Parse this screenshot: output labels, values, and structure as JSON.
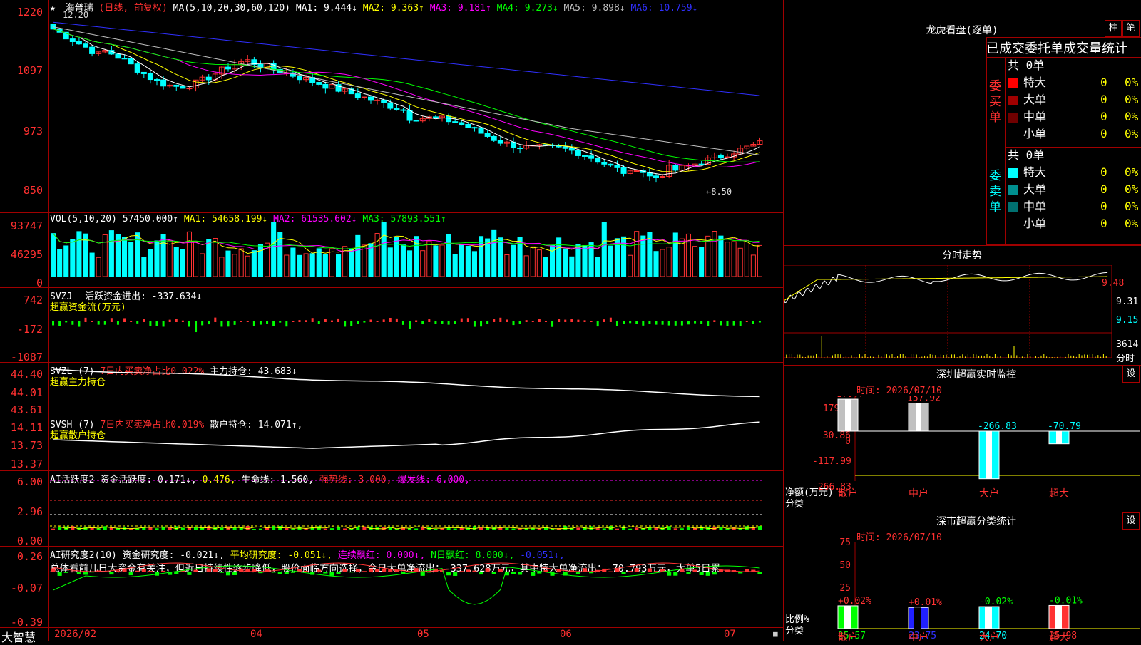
{
  "colors": {
    "up": "#ff3232",
    "down": "#00ffff",
    "ma1": "#ffffff",
    "ma2": "#ffff00",
    "ma3": "#ff00ff",
    "ma4": "#00ff00",
    "ma5": "#c0c0c0",
    "ma6": "#3030ff",
    "border": "#a00000",
    "green": "#00ff00"
  },
  "header": {
    "stock_name": "海普瑞",
    "period": "(日线, 前复权)",
    "ma_params": "MA(5,10,20,30,60,120)",
    "ma1": "MA1: 9.444↓",
    "ma2": "MA2: 9.363↑",
    "ma3": "MA3: 9.181↑",
    "ma4": "MA4: 9.273↓",
    "ma5": "MA5: 9.898↓",
    "ma6": "MA6: 10.759↓",
    "high_label": "12.20",
    "low_label": "←8.50"
  },
  "price_axis": [
    "1220",
    "1097",
    "973",
    "850"
  ],
  "vol_axis": [
    "93747",
    "46295",
    "0"
  ],
  "vol": {
    "title": "VOL(5,10,20)",
    "value": "57450.000↑",
    "ma1": "MA1: 54658.199↓",
    "ma2": "MA2: 61535.602↓",
    "ma3": "MA3: 57893.551↑"
  },
  "svzj": {
    "axis": [
      "742",
      "-172",
      "-1087"
    ],
    "title": "SVZJ",
    "label": "活跃资金进出: -337.634↓",
    "sub": "超赢资金流(万元)"
  },
  "svzl": {
    "axis": [
      "44.40",
      "44.01",
      "43.61"
    ],
    "title": "SVZL (7)",
    "ratio": "7日内买卖净占比0.022%",
    "label": "主力持仓: 43.683↓",
    "sub": "超赢主力持仓"
  },
  "svsh": {
    "axis": [
      "14.11",
      "13.73",
      "13.37"
    ],
    "title": "SVSH (7)",
    "ratio": "7日内买卖净占比0.019%",
    "label": "散户持仓: 14.071↑,",
    "sub": "超赢散户持仓"
  },
  "ai1": {
    "axis": [
      "6.00",
      "2.96",
      "0.00"
    ],
    "title": "AI活跃度2",
    "l1": "资金活跃度: 0.171↓,",
    "l2": "0.476,",
    "l3": "生命线: 1.560,",
    "l4": "强势线: 3.000,",
    "l5": "爆发线: 6.000,"
  },
  "ai2": {
    "axis": [
      "0.26",
      "-0.07",
      "-0.39"
    ],
    "title": "AI研究度2(10)",
    "l1": "资金研究度: -0.021↓,",
    "l2": "平均研究度: -0.051↓,",
    "l3": "连续飘红: 0.000↓,",
    "l4": "N日飘红: 8.000↓,",
    "l5": "-0.051↓,",
    "comment": "总体看前几日大资金有关注，但近日持续性逐步降低，股价面临方向选择，今日大单净流出：-337.628万元，其中特大单净流出：-70.793万元，大单5日累"
  },
  "date_axis": [
    "2026/02",
    "04",
    "05",
    "06",
    "07"
  ],
  "brand": "大智慧",
  "right": {
    "lhb_title": "龙虎看盘(逐单)",
    "btn_zhu": "柱",
    "btn_bi": "笔",
    "tabs": "已成交委托单成交量统计",
    "buy_label": "委买单",
    "buy_total": "共 0单",
    "sell_label": "委卖单",
    "sell_total": "共 0单",
    "buy_rows": [
      {
        "name": "特大",
        "n": "0",
        "p": "0%",
        "c": "#ff0000"
      },
      {
        "name": "大单",
        "n": "0",
        "p": "0%",
        "c": "#a00000"
      },
      {
        "name": "中单",
        "n": "0",
        "p": "0%",
        "c": "#700000"
      },
      {
        "name": "小单",
        "n": "0",
        "p": "0%",
        "c": "#000000"
      }
    ],
    "sell_rows": [
      {
        "name": "特大",
        "n": "0",
        "p": "0%",
        "c": "#00ffff"
      },
      {
        "name": "大单",
        "n": "0",
        "p": "0%",
        "c": "#009090"
      },
      {
        "name": "中单",
        "n": "0",
        "p": "0%",
        "c": "#007070"
      },
      {
        "name": "小单",
        "n": "0",
        "p": "0%",
        "c": "#000000"
      }
    ],
    "fenshi_title": "分时走势",
    "fenshi_axis": [
      "9.48",
      "9.31",
      "9.15"
    ],
    "fenshi_vol": "3614",
    "fenshi_lbl": "分时",
    "sz_title": "深圳超赢实时监控",
    "sz_btn": "设",
    "sz_time": "时间: 2026/07/10",
    "sz_axis": [
      "179.7",
      "30.86",
      "0",
      "-117.99",
      "-266.83"
    ],
    "sz_ylabel": "净额(万元)",
    "sz_xlabel": "分类",
    "sz_values": [
      "179.7",
      "157.92",
      "-266.83",
      "-70.79"
    ],
    "cats": [
      "散户",
      "中户",
      "大户",
      "超大"
    ],
    "fl_title": "深市超赢分类统计",
    "fl_btn": "设",
    "fl_time": "时间: 2026/07/10",
    "fl_axis": [
      "75",
      "50",
      "25",
      "0"
    ],
    "fl_ylabel": "比例%",
    "fl_xlabel": "分类",
    "fl_pct": [
      "+0.02%",
      "+0.01%",
      "-0.02%",
      "-0.01%"
    ],
    "fl_vals": [
      "25.57",
      "23.75",
      "24.70",
      "25.98"
    ]
  }
}
